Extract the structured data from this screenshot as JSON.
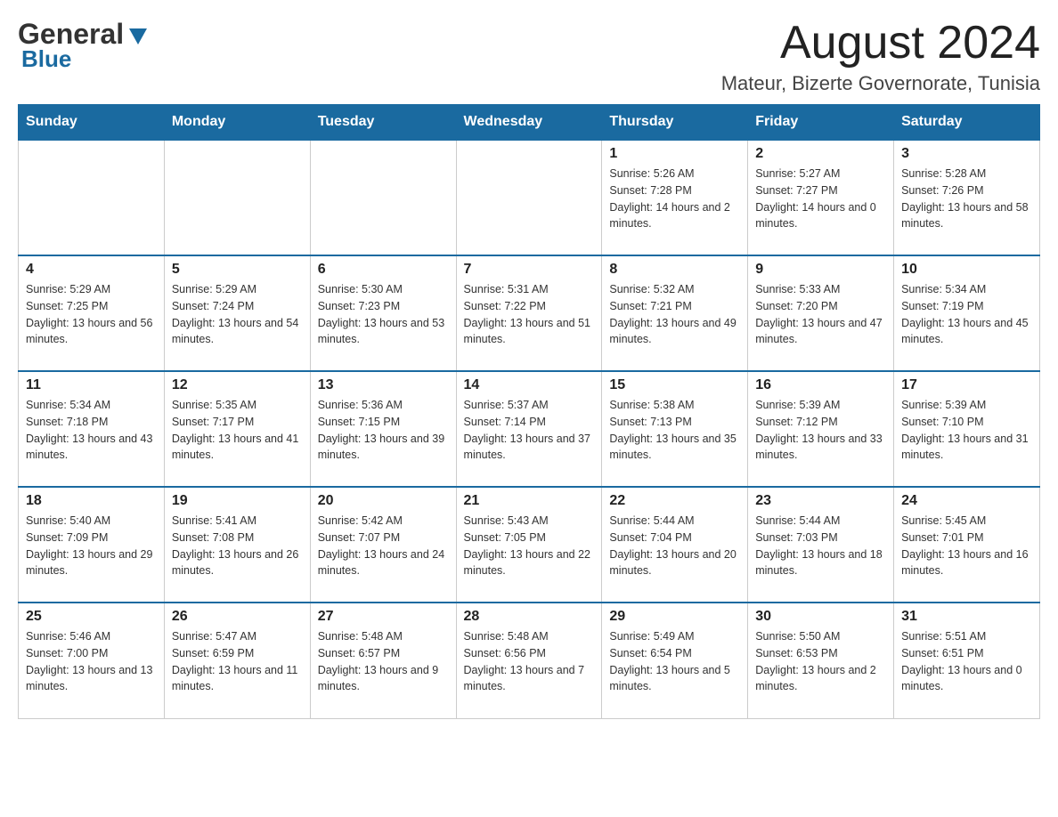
{
  "header": {
    "logo_general": "General",
    "logo_blue": "Blue",
    "month_title": "August 2024",
    "location": "Mateur, Bizerte Governorate, Tunisia"
  },
  "days_of_week": [
    "Sunday",
    "Monday",
    "Tuesday",
    "Wednesday",
    "Thursday",
    "Friday",
    "Saturday"
  ],
  "weeks": [
    [
      {
        "day": "",
        "sunrise": "",
        "sunset": "",
        "daylight": ""
      },
      {
        "day": "",
        "sunrise": "",
        "sunset": "",
        "daylight": ""
      },
      {
        "day": "",
        "sunrise": "",
        "sunset": "",
        "daylight": ""
      },
      {
        "day": "",
        "sunrise": "",
        "sunset": "",
        "daylight": ""
      },
      {
        "day": "1",
        "sunrise": "Sunrise: 5:26 AM",
        "sunset": "Sunset: 7:28 PM",
        "daylight": "Daylight: 14 hours and 2 minutes."
      },
      {
        "day": "2",
        "sunrise": "Sunrise: 5:27 AM",
        "sunset": "Sunset: 7:27 PM",
        "daylight": "Daylight: 14 hours and 0 minutes."
      },
      {
        "day": "3",
        "sunrise": "Sunrise: 5:28 AM",
        "sunset": "Sunset: 7:26 PM",
        "daylight": "Daylight: 13 hours and 58 minutes."
      }
    ],
    [
      {
        "day": "4",
        "sunrise": "Sunrise: 5:29 AM",
        "sunset": "Sunset: 7:25 PM",
        "daylight": "Daylight: 13 hours and 56 minutes."
      },
      {
        "day": "5",
        "sunrise": "Sunrise: 5:29 AM",
        "sunset": "Sunset: 7:24 PM",
        "daylight": "Daylight: 13 hours and 54 minutes."
      },
      {
        "day": "6",
        "sunrise": "Sunrise: 5:30 AM",
        "sunset": "Sunset: 7:23 PM",
        "daylight": "Daylight: 13 hours and 53 minutes."
      },
      {
        "day": "7",
        "sunrise": "Sunrise: 5:31 AM",
        "sunset": "Sunset: 7:22 PM",
        "daylight": "Daylight: 13 hours and 51 minutes."
      },
      {
        "day": "8",
        "sunrise": "Sunrise: 5:32 AM",
        "sunset": "Sunset: 7:21 PM",
        "daylight": "Daylight: 13 hours and 49 minutes."
      },
      {
        "day": "9",
        "sunrise": "Sunrise: 5:33 AM",
        "sunset": "Sunset: 7:20 PM",
        "daylight": "Daylight: 13 hours and 47 minutes."
      },
      {
        "day": "10",
        "sunrise": "Sunrise: 5:34 AM",
        "sunset": "Sunset: 7:19 PM",
        "daylight": "Daylight: 13 hours and 45 minutes."
      }
    ],
    [
      {
        "day": "11",
        "sunrise": "Sunrise: 5:34 AM",
        "sunset": "Sunset: 7:18 PM",
        "daylight": "Daylight: 13 hours and 43 minutes."
      },
      {
        "day": "12",
        "sunrise": "Sunrise: 5:35 AM",
        "sunset": "Sunset: 7:17 PM",
        "daylight": "Daylight: 13 hours and 41 minutes."
      },
      {
        "day": "13",
        "sunrise": "Sunrise: 5:36 AM",
        "sunset": "Sunset: 7:15 PM",
        "daylight": "Daylight: 13 hours and 39 minutes."
      },
      {
        "day": "14",
        "sunrise": "Sunrise: 5:37 AM",
        "sunset": "Sunset: 7:14 PM",
        "daylight": "Daylight: 13 hours and 37 minutes."
      },
      {
        "day": "15",
        "sunrise": "Sunrise: 5:38 AM",
        "sunset": "Sunset: 7:13 PM",
        "daylight": "Daylight: 13 hours and 35 minutes."
      },
      {
        "day": "16",
        "sunrise": "Sunrise: 5:39 AM",
        "sunset": "Sunset: 7:12 PM",
        "daylight": "Daylight: 13 hours and 33 minutes."
      },
      {
        "day": "17",
        "sunrise": "Sunrise: 5:39 AM",
        "sunset": "Sunset: 7:10 PM",
        "daylight": "Daylight: 13 hours and 31 minutes."
      }
    ],
    [
      {
        "day": "18",
        "sunrise": "Sunrise: 5:40 AM",
        "sunset": "Sunset: 7:09 PM",
        "daylight": "Daylight: 13 hours and 29 minutes."
      },
      {
        "day": "19",
        "sunrise": "Sunrise: 5:41 AM",
        "sunset": "Sunset: 7:08 PM",
        "daylight": "Daylight: 13 hours and 26 minutes."
      },
      {
        "day": "20",
        "sunrise": "Sunrise: 5:42 AM",
        "sunset": "Sunset: 7:07 PM",
        "daylight": "Daylight: 13 hours and 24 minutes."
      },
      {
        "day": "21",
        "sunrise": "Sunrise: 5:43 AM",
        "sunset": "Sunset: 7:05 PM",
        "daylight": "Daylight: 13 hours and 22 minutes."
      },
      {
        "day": "22",
        "sunrise": "Sunrise: 5:44 AM",
        "sunset": "Sunset: 7:04 PM",
        "daylight": "Daylight: 13 hours and 20 minutes."
      },
      {
        "day": "23",
        "sunrise": "Sunrise: 5:44 AM",
        "sunset": "Sunset: 7:03 PM",
        "daylight": "Daylight: 13 hours and 18 minutes."
      },
      {
        "day": "24",
        "sunrise": "Sunrise: 5:45 AM",
        "sunset": "Sunset: 7:01 PM",
        "daylight": "Daylight: 13 hours and 16 minutes."
      }
    ],
    [
      {
        "day": "25",
        "sunrise": "Sunrise: 5:46 AM",
        "sunset": "Sunset: 7:00 PM",
        "daylight": "Daylight: 13 hours and 13 minutes."
      },
      {
        "day": "26",
        "sunrise": "Sunrise: 5:47 AM",
        "sunset": "Sunset: 6:59 PM",
        "daylight": "Daylight: 13 hours and 11 minutes."
      },
      {
        "day": "27",
        "sunrise": "Sunrise: 5:48 AM",
        "sunset": "Sunset: 6:57 PM",
        "daylight": "Daylight: 13 hours and 9 minutes."
      },
      {
        "day": "28",
        "sunrise": "Sunrise: 5:48 AM",
        "sunset": "Sunset: 6:56 PM",
        "daylight": "Daylight: 13 hours and 7 minutes."
      },
      {
        "day": "29",
        "sunrise": "Sunrise: 5:49 AM",
        "sunset": "Sunset: 6:54 PM",
        "daylight": "Daylight: 13 hours and 5 minutes."
      },
      {
        "day": "30",
        "sunrise": "Sunrise: 5:50 AM",
        "sunset": "Sunset: 6:53 PM",
        "daylight": "Daylight: 13 hours and 2 minutes."
      },
      {
        "day": "31",
        "sunrise": "Sunrise: 5:51 AM",
        "sunset": "Sunset: 6:51 PM",
        "daylight": "Daylight: 13 hours and 0 minutes."
      }
    ]
  ]
}
